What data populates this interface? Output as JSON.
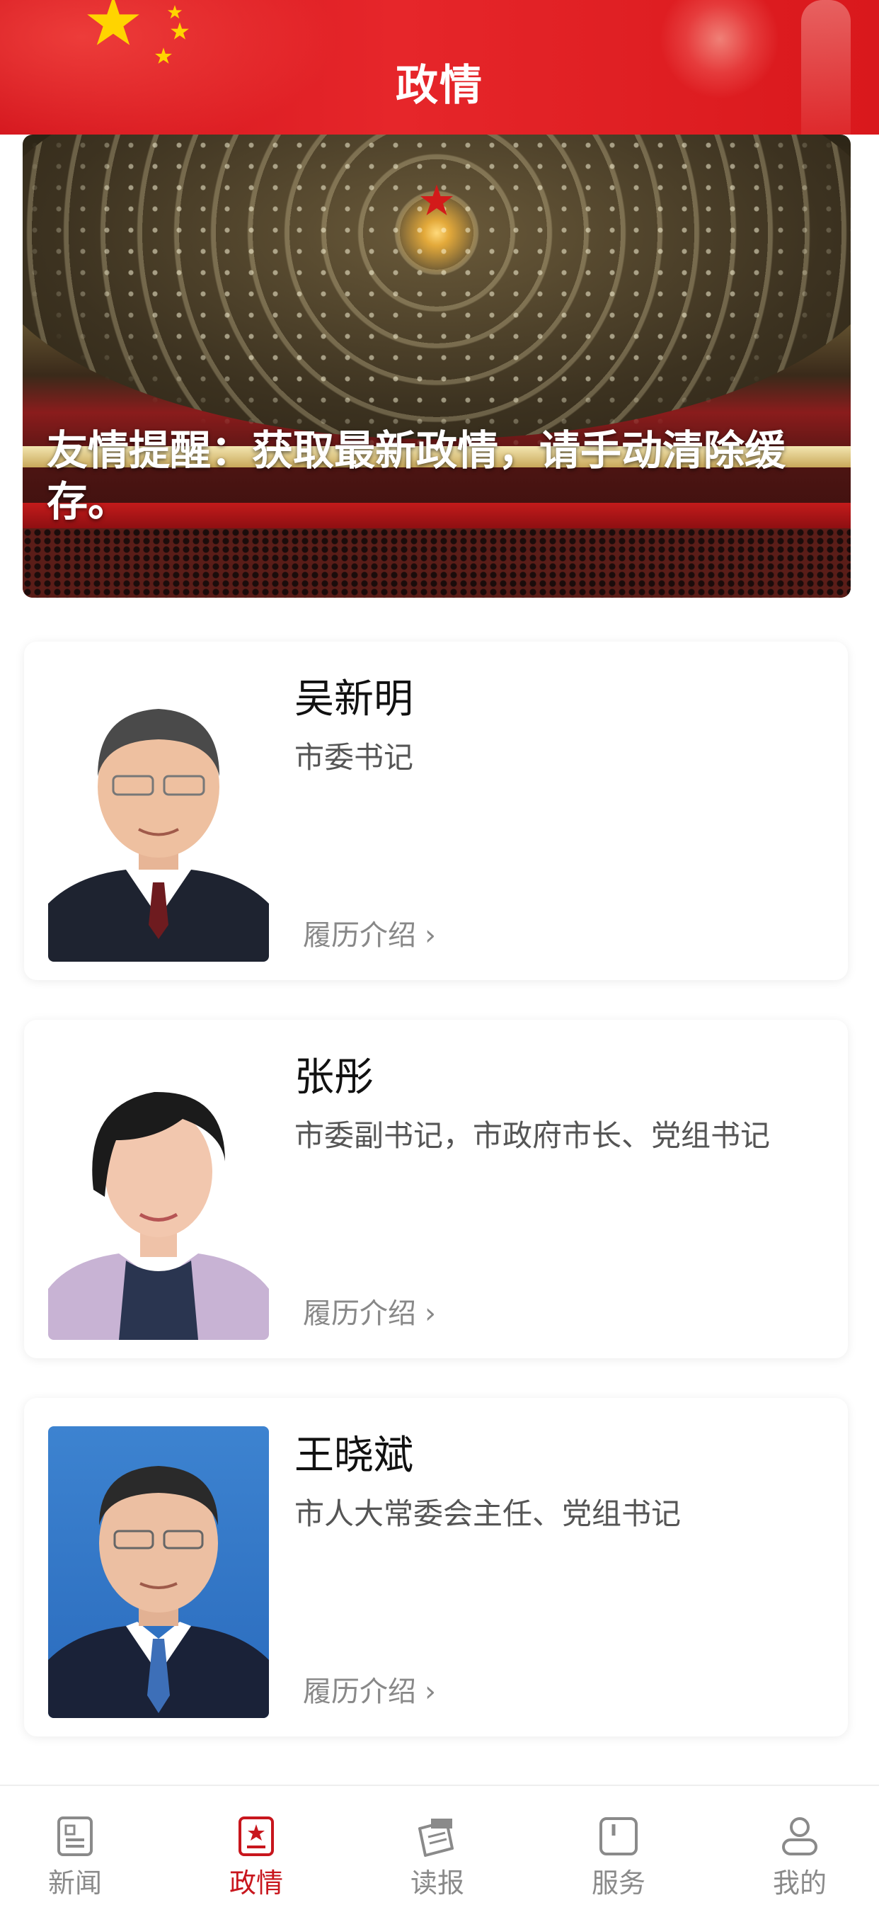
{
  "header": {
    "title": "政情"
  },
  "banner": {
    "caption": "友情提醒：获取最新政情，请手动清除缓存。"
  },
  "leaders": [
    {
      "name": "吴新明",
      "title": "市委书记",
      "link_label": "履历介绍"
    },
    {
      "name": "张彤",
      "title": "市委副书记，市政府市长、党组书记",
      "link_label": "履历介绍"
    },
    {
      "name": "王晓斌",
      "title": "市人大常委会主任、党组书记",
      "link_label": "履历介绍"
    }
  ],
  "tabbar": {
    "items": [
      {
        "label": "新闻",
        "icon": "news-icon",
        "active": false
      },
      {
        "label": "政情",
        "icon": "politics-icon",
        "active": true
      },
      {
        "label": "读报",
        "icon": "newspaper-icon",
        "active": false
      },
      {
        "label": "服务",
        "icon": "service-icon",
        "active": false
      },
      {
        "label": "我的",
        "icon": "profile-icon",
        "active": false
      }
    ]
  },
  "colors": {
    "brand_red": "#c8161d",
    "header_red": "#e0221f",
    "tab_inactive": "#8a8a8a"
  }
}
